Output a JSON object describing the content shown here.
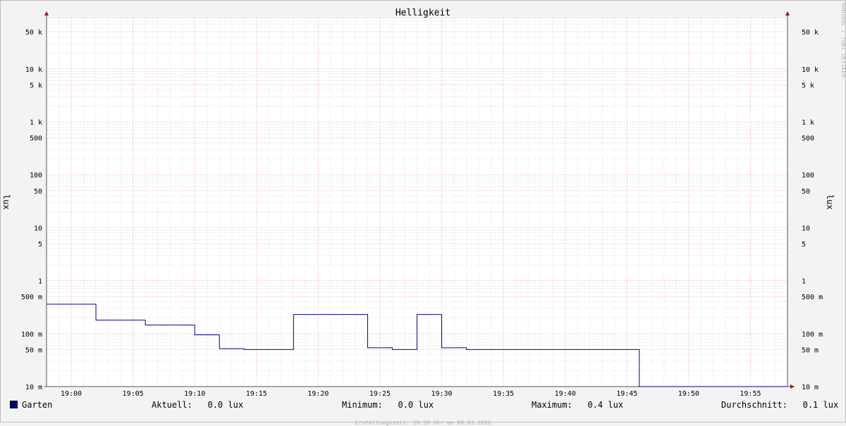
{
  "chart_data": {
    "type": "line",
    "title": "Helligkeit",
    "ylabel": "lux",
    "y_scale": "log",
    "ylim": [
      10,
      90000
    ],
    "xlim": [
      "18:58",
      "19:58"
    ],
    "x_ticks": [
      "19:00",
      "19:05",
      "19:10",
      "19:15",
      "19:20",
      "19:25",
      "19:30",
      "19:35",
      "19:40",
      "19:45",
      "19:50",
      "19:55"
    ],
    "y_ticks": [
      {
        "value": 50000,
        "label": "50 k"
      },
      {
        "value": 10000,
        "label": "10 k"
      },
      {
        "value": 5000,
        "label": "5 k"
      },
      {
        "value": 1000,
        "label": "1 k"
      },
      {
        "value": 500,
        "label": "500"
      },
      {
        "value": 100,
        "label": "100"
      },
      {
        "value": 50,
        "label": "50"
      },
      {
        "value": 10,
        "label": "10"
      },
      {
        "value": 5,
        "label": "5"
      },
      {
        "value": 1,
        "label": "1"
      },
      {
        "value": 0.5,
        "label": "500 m"
      },
      {
        "value": 0.1,
        "label": "100 m"
      },
      {
        "value": 0.05,
        "label": "50 m"
      },
      {
        "value": 0.01,
        "label": "10 m"
      }
    ],
    "series": [
      {
        "name": "Garten",
        "color": "#00008b",
        "step": true,
        "x": [
          "18:58",
          "19:02",
          "19:06",
          "19:10",
          "19:12",
          "19:14",
          "19:18",
          "19:24",
          "19:26",
          "19:28",
          "19:30",
          "19:32",
          "19:46",
          "19:58"
        ],
        "values": [
          0.36,
          0.18,
          0.145,
          0.095,
          0.052,
          0.05,
          0.23,
          0.054,
          0.05,
          0.23,
          0.054,
          0.05,
          0.0,
          0.0
        ]
      }
    ],
    "grid": true,
    "colors": {
      "major_grid": "#e8a0a0",
      "minor_grid": "#c8c8c8",
      "arrow": "#8b1a1a"
    }
  },
  "legend": {
    "series_name": "Garten",
    "current_label": "Aktuell:",
    "current_value": "0.0 lux",
    "min_label": "Minimum:",
    "min_value": "0.0 lux",
    "max_label": "Maximum:",
    "max_value": "0.4 lux",
    "avg_label": "Durchschnitt:",
    "avg_value": "0.1 lux"
  },
  "credit": "Erstellungszeit: 19:58 Uhr am 09.03.2026",
  "watermark": "RRDTOOL / TOBI OETIKER"
}
